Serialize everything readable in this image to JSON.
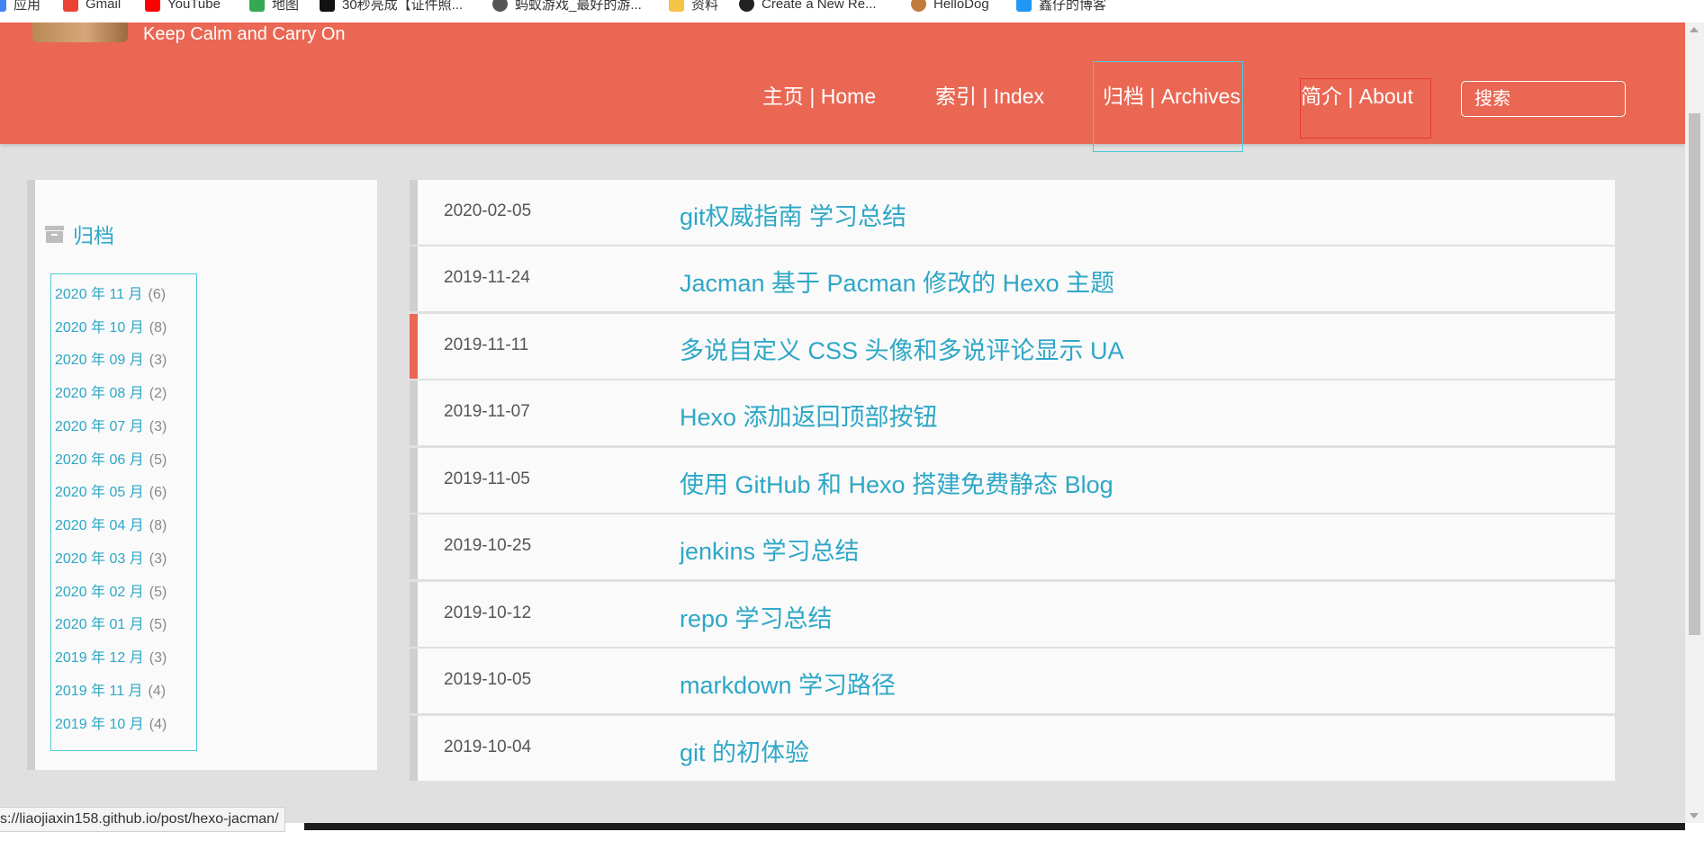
{
  "bookmarks": [
    {
      "label": "应用",
      "icon": "apps-grid-icon",
      "color": "#4285f4"
    },
    {
      "label": "Gmail",
      "icon": "gmail-icon",
      "color": "#ea4335"
    },
    {
      "label": "YouTube",
      "icon": "youtube-icon",
      "color": "#ff0000"
    },
    {
      "label": "地图",
      "icon": "maps-icon",
      "color": "#34a853"
    },
    {
      "label": "30秒亮成【证件照...",
      "icon": "tiktok-icon",
      "color": "#111111"
    },
    {
      "label": "蚂蚁游戏_最好的游...",
      "icon": "globe-icon",
      "color": "#555555"
    },
    {
      "label": "资料",
      "icon": "folder-icon",
      "color": "#f6c445"
    },
    {
      "label": "Create a New Re...",
      "icon": "github-icon",
      "color": "#222222"
    },
    {
      "label": "HelloDog",
      "icon": "dog-icon",
      "color": "#c27c3a"
    },
    {
      "label": "鑫仔的博客",
      "icon": "blog-icon",
      "color": "#2196f3"
    }
  ],
  "header": {
    "tagline": "Keep Calm and Carry On",
    "nav": [
      {
        "label": "主页 | Home"
      },
      {
        "label": "索引 | Index"
      },
      {
        "label": "归档 | Archives"
      },
      {
        "label": "简介 | About"
      }
    ],
    "search_placeholder": "搜索",
    "accent_color": "#ea6753"
  },
  "sidebar": {
    "title": "归档",
    "archives": [
      {
        "label": "2020 年 11 月",
        "count": "(6)"
      },
      {
        "label": "2020 年 10 月",
        "count": "(8)"
      },
      {
        "label": "2020 年 09 月",
        "count": "(3)"
      },
      {
        "label": "2020 年 08 月",
        "count": "(2)"
      },
      {
        "label": "2020 年 07 月",
        "count": "(3)"
      },
      {
        "label": "2020 年 06 月",
        "count": "(5)"
      },
      {
        "label": "2020 年 05 月",
        "count": "(6)"
      },
      {
        "label": "2020 年 04 月",
        "count": "(8)"
      },
      {
        "label": "2020 年 03 月",
        "count": "(3)"
      },
      {
        "label": "2020 年 02 月",
        "count": "(5)"
      },
      {
        "label": "2020 年 01 月",
        "count": "(5)"
      },
      {
        "label": "2019 年 12 月",
        "count": "(3)"
      },
      {
        "label": "2019 年 11 月",
        "count": "(4)"
      },
      {
        "label": "2019 年 10 月",
        "count": "(4)"
      }
    ]
  },
  "posts": [
    {
      "date": "2020-02-05",
      "title": "git权威指南 学习总结"
    },
    {
      "date": "2019-11-24",
      "title": "Jacman 基于 Pacman 修改的 Hexo 主题"
    },
    {
      "date": "2019-11-11",
      "title": "多说自定义 CSS 头像和多说评论显示 UA"
    },
    {
      "date": "2019-11-07",
      "title": "Hexo 添加返回顶部按钮"
    },
    {
      "date": "2019-11-05",
      "title": "使用 GitHub 和 Hexo 搭建免费静态 Blog"
    },
    {
      "date": "2019-10-25",
      "title": "jenkins 学习总结"
    },
    {
      "date": "2019-10-12",
      "title": "repo 学习总结"
    },
    {
      "date": "2019-10-05",
      "title": "markdown 学习路径"
    },
    {
      "date": "2019-10-04",
      "title": "git 的初体验"
    }
  ],
  "status_url": "s://liaojiaxin158.github.io/post/hexo-jacman/"
}
